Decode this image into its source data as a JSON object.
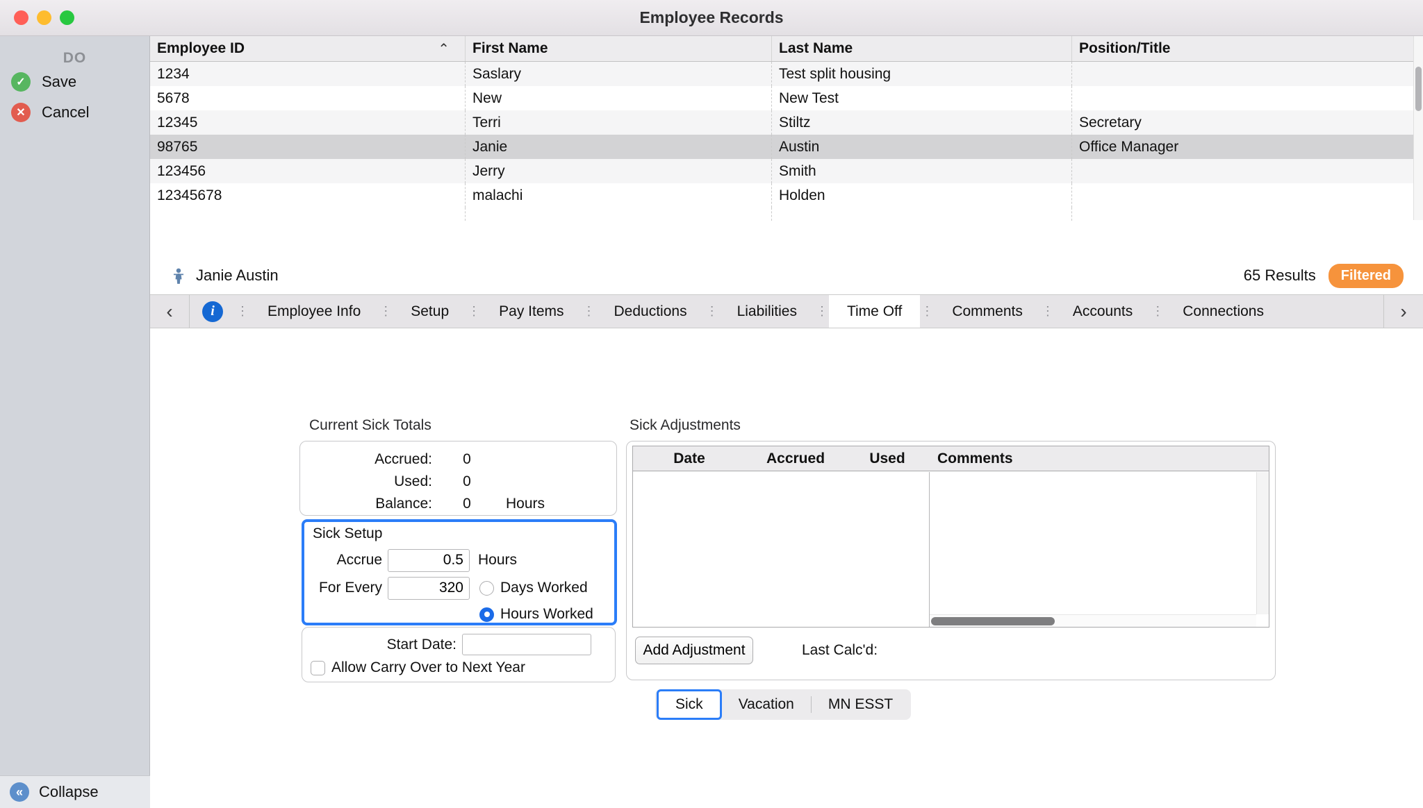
{
  "window": {
    "title": "Employee Records"
  },
  "sidebar": {
    "header": "DO",
    "actions": [
      {
        "label": "Save",
        "glyph": "✓"
      },
      {
        "label": "Cancel",
        "glyph": "✕"
      }
    ],
    "collapse": {
      "label": "Collapse",
      "glyph": "«"
    }
  },
  "employee_table": {
    "columns": [
      "Employee ID",
      "First Name",
      "Last Name",
      "Position/Title"
    ],
    "sort_glyph": "⌃",
    "rows": [
      {
        "id": "1234",
        "first_name": "Saslary",
        "last_name": "Test split housing",
        "position": ""
      },
      {
        "id": "5678",
        "first_name": "New",
        "last_name": "New Test",
        "position": ""
      },
      {
        "id": "12345",
        "first_name": "Terri",
        "last_name": "Stiltz",
        "position": "Secretary"
      },
      {
        "id": "98765",
        "first_name": "Janie",
        "last_name": "Austin",
        "position": "Office Manager"
      },
      {
        "id": "123456",
        "first_name": "Jerry",
        "last_name": "Smith",
        "position": ""
      },
      {
        "id": "12345678",
        "first_name": "malachi",
        "last_name": "Holden",
        "position": ""
      }
    ],
    "selected_row_id": "98765"
  },
  "record_bar": {
    "name": "Janie Austin",
    "results": "65 Results",
    "filter_badge": "Filtered"
  },
  "tabs": {
    "prev_glyph": "‹",
    "next_glyph": "›",
    "separator_glyph": "⋮",
    "info_glyph": "i",
    "items": [
      "Employee Info",
      "Setup",
      "Pay Items",
      "Deductions",
      "Liabilities",
      "Time Off",
      "Comments",
      "Accounts",
      "Connections"
    ],
    "active": "Time Off"
  },
  "time_off": {
    "totals": {
      "title": "Current Sick Totals",
      "rows": [
        {
          "label": "Accrued:",
          "value": "0",
          "suffix": ""
        },
        {
          "label": "Used:",
          "value": "0",
          "suffix": ""
        },
        {
          "label": "Balance:",
          "value": "0",
          "suffix": "Hours"
        }
      ]
    },
    "setup": {
      "title": "Sick Setup",
      "accrue_label": "Accrue",
      "accrue_value": "0.5",
      "accrue_suffix": "Hours",
      "for_every_label": "For Every",
      "for_every_value": "320",
      "radio_options": [
        "Days Worked",
        "Hours Worked"
      ],
      "radio_selected": "Hours Worked"
    },
    "start_date_label": "Start Date:",
    "start_date_value": "",
    "carry_over_label": "Allow Carry Over to Next Year",
    "carry_over_checked": false,
    "adjustments": {
      "title": "Sick Adjustments",
      "columns": [
        "Date",
        "Accrued",
        "Used",
        "Comments"
      ],
      "rows": [],
      "add_button_label": "Add Adjustment",
      "last_calcd_label": "Last Calc'd:"
    },
    "category_tabs": {
      "items": [
        "Sick",
        "Vacation",
        "MN ESST"
      ],
      "active": "Sick"
    }
  },
  "colors": {
    "highlight_blue": "#2B7DF8",
    "filtered_badge_orange": "#F6933C",
    "info_icon_blue": "#1568D3",
    "save_green": "#57B660",
    "cancel_red": "#E25C4F"
  }
}
